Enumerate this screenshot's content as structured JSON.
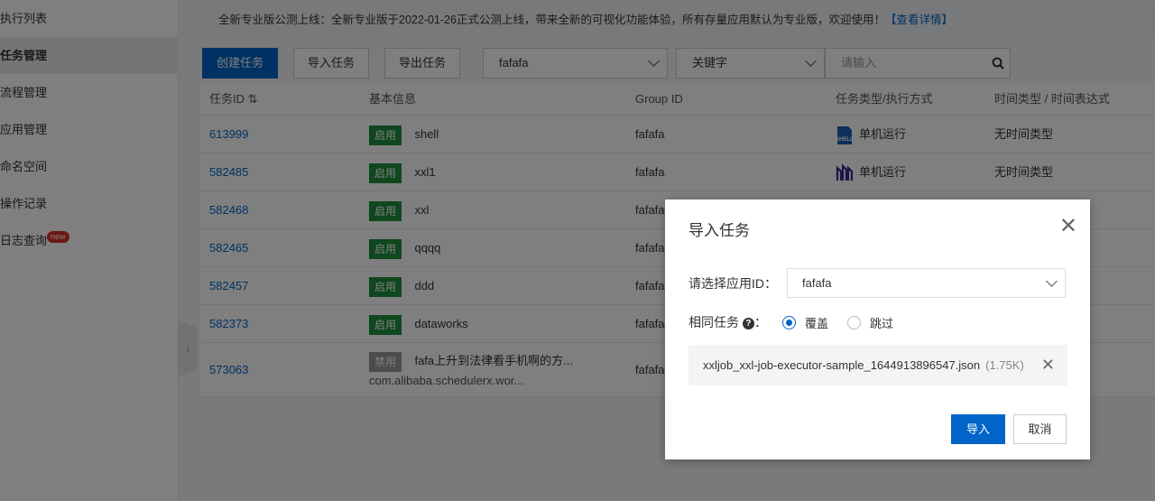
{
  "sidebar": {
    "items": [
      {
        "label": "执行列表"
      },
      {
        "label": "任务管理",
        "active": true
      },
      {
        "label": "流程管理"
      },
      {
        "label": "应用管理"
      },
      {
        "label": "命名空间"
      },
      {
        "label": "操作记录"
      },
      {
        "label": "日志查询",
        "badge": "new"
      }
    ]
  },
  "banner": {
    "text": "全新专业版公测上线：全新专业版于2022-01-26正式公测上线，带来全新的可视化功能体验，所有存量应用默认为专业版，欢迎使用！",
    "link": "【查看详情】"
  },
  "toolbar": {
    "create": "创建任务",
    "import": "导入任务",
    "export": "导出任务",
    "app_select": "fafafa",
    "filter_select": "关键字",
    "search_placeholder": "请输入"
  },
  "table": {
    "headers": [
      "任务ID",
      "基本信息",
      "Group ID",
      "任务类型/执行方式",
      "时间类型 / 时间表达式"
    ],
    "rows": [
      {
        "id": "613999",
        "status": "启用",
        "name": "shell",
        "group": "fafafa",
        "type_icon": "shell-icon",
        "exec": "单机运行",
        "time": "无时间类型"
      },
      {
        "id": "582485",
        "status": "启用",
        "name": "xxl1",
        "group": "fafafa",
        "type_icon": "xxljob-icon",
        "exec": "单机运行",
        "time": "无时间类型"
      },
      {
        "id": "582468",
        "status": "启用",
        "name": "xxl",
        "group": "fafafa"
      },
      {
        "id": "582465",
        "status": "启用",
        "name": "qqqq",
        "group": "fafafa"
      },
      {
        "id": "582457",
        "status": "启用",
        "name": "ddd",
        "group": "fafafa"
      },
      {
        "id": "582373",
        "status": "启用",
        "name": "dataworks",
        "group": "fafafa"
      },
      {
        "id": "573063",
        "status": "禁用",
        "name": "fafa上升到法律看手机啊的方...",
        "sub": "com.alibaba.schedulerx.wor...",
        "group": "fafafa"
      }
    ]
  },
  "modal": {
    "title": "导入任务",
    "app_label": "请选择应用ID：",
    "app_value": "fafafa",
    "same_label": "相同任务",
    "same_colon": "：",
    "options": [
      {
        "label": "覆盖",
        "checked": true
      },
      {
        "label": "跳过",
        "checked": false
      }
    ],
    "file_name": "xxljob_xxl-job-executor-sample_1644913896547.json",
    "file_size": "(1.75K)",
    "ok": "导入",
    "cancel": "取消"
  },
  "colors": {
    "primary": "#0064c8",
    "enabled": "#1e8e3e",
    "disabled": "#999999"
  }
}
